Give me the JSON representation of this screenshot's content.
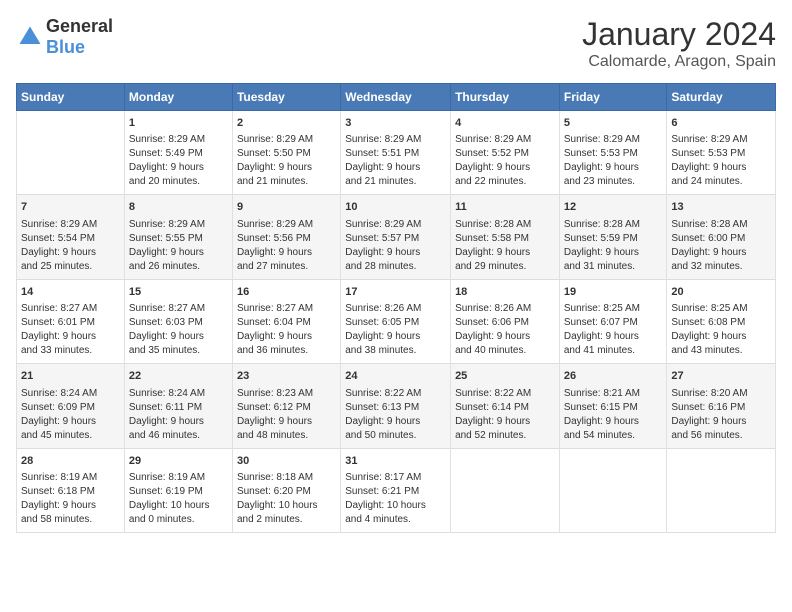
{
  "header": {
    "logo_general": "General",
    "logo_blue": "Blue",
    "month": "January 2024",
    "location": "Calomarde, Aragon, Spain"
  },
  "days_of_week": [
    "Sunday",
    "Monday",
    "Tuesday",
    "Wednesday",
    "Thursday",
    "Friday",
    "Saturday"
  ],
  "weeks": [
    [
      {
        "day": "",
        "info": ""
      },
      {
        "day": "1",
        "info": "Sunrise: 8:29 AM\nSunset: 5:49 PM\nDaylight: 9 hours\nand 20 minutes."
      },
      {
        "day": "2",
        "info": "Sunrise: 8:29 AM\nSunset: 5:50 PM\nDaylight: 9 hours\nand 21 minutes."
      },
      {
        "day": "3",
        "info": "Sunrise: 8:29 AM\nSunset: 5:51 PM\nDaylight: 9 hours\nand 21 minutes."
      },
      {
        "day": "4",
        "info": "Sunrise: 8:29 AM\nSunset: 5:52 PM\nDaylight: 9 hours\nand 22 minutes."
      },
      {
        "day": "5",
        "info": "Sunrise: 8:29 AM\nSunset: 5:53 PM\nDaylight: 9 hours\nand 23 minutes."
      },
      {
        "day": "6",
        "info": "Sunrise: 8:29 AM\nSunset: 5:53 PM\nDaylight: 9 hours\nand 24 minutes."
      }
    ],
    [
      {
        "day": "7",
        "info": "Sunrise: 8:29 AM\nSunset: 5:54 PM\nDaylight: 9 hours\nand 25 minutes."
      },
      {
        "day": "8",
        "info": "Sunrise: 8:29 AM\nSunset: 5:55 PM\nDaylight: 9 hours\nand 26 minutes."
      },
      {
        "day": "9",
        "info": "Sunrise: 8:29 AM\nSunset: 5:56 PM\nDaylight: 9 hours\nand 27 minutes."
      },
      {
        "day": "10",
        "info": "Sunrise: 8:29 AM\nSunset: 5:57 PM\nDaylight: 9 hours\nand 28 minutes."
      },
      {
        "day": "11",
        "info": "Sunrise: 8:28 AM\nSunset: 5:58 PM\nDaylight: 9 hours\nand 29 minutes."
      },
      {
        "day": "12",
        "info": "Sunrise: 8:28 AM\nSunset: 5:59 PM\nDaylight: 9 hours\nand 31 minutes."
      },
      {
        "day": "13",
        "info": "Sunrise: 8:28 AM\nSunset: 6:00 PM\nDaylight: 9 hours\nand 32 minutes."
      }
    ],
    [
      {
        "day": "14",
        "info": "Sunrise: 8:27 AM\nSunset: 6:01 PM\nDaylight: 9 hours\nand 33 minutes."
      },
      {
        "day": "15",
        "info": "Sunrise: 8:27 AM\nSunset: 6:03 PM\nDaylight: 9 hours\nand 35 minutes."
      },
      {
        "day": "16",
        "info": "Sunrise: 8:27 AM\nSunset: 6:04 PM\nDaylight: 9 hours\nand 36 minutes."
      },
      {
        "day": "17",
        "info": "Sunrise: 8:26 AM\nSunset: 6:05 PM\nDaylight: 9 hours\nand 38 minutes."
      },
      {
        "day": "18",
        "info": "Sunrise: 8:26 AM\nSunset: 6:06 PM\nDaylight: 9 hours\nand 40 minutes."
      },
      {
        "day": "19",
        "info": "Sunrise: 8:25 AM\nSunset: 6:07 PM\nDaylight: 9 hours\nand 41 minutes."
      },
      {
        "day": "20",
        "info": "Sunrise: 8:25 AM\nSunset: 6:08 PM\nDaylight: 9 hours\nand 43 minutes."
      }
    ],
    [
      {
        "day": "21",
        "info": "Sunrise: 8:24 AM\nSunset: 6:09 PM\nDaylight: 9 hours\nand 45 minutes."
      },
      {
        "day": "22",
        "info": "Sunrise: 8:24 AM\nSunset: 6:11 PM\nDaylight: 9 hours\nand 46 minutes."
      },
      {
        "day": "23",
        "info": "Sunrise: 8:23 AM\nSunset: 6:12 PM\nDaylight: 9 hours\nand 48 minutes."
      },
      {
        "day": "24",
        "info": "Sunrise: 8:22 AM\nSunset: 6:13 PM\nDaylight: 9 hours\nand 50 minutes."
      },
      {
        "day": "25",
        "info": "Sunrise: 8:22 AM\nSunset: 6:14 PM\nDaylight: 9 hours\nand 52 minutes."
      },
      {
        "day": "26",
        "info": "Sunrise: 8:21 AM\nSunset: 6:15 PM\nDaylight: 9 hours\nand 54 minutes."
      },
      {
        "day": "27",
        "info": "Sunrise: 8:20 AM\nSunset: 6:16 PM\nDaylight: 9 hours\nand 56 minutes."
      }
    ],
    [
      {
        "day": "28",
        "info": "Sunrise: 8:19 AM\nSunset: 6:18 PM\nDaylight: 9 hours\nand 58 minutes."
      },
      {
        "day": "29",
        "info": "Sunrise: 8:19 AM\nSunset: 6:19 PM\nDaylight: 10 hours\nand 0 minutes."
      },
      {
        "day": "30",
        "info": "Sunrise: 8:18 AM\nSunset: 6:20 PM\nDaylight: 10 hours\nand 2 minutes."
      },
      {
        "day": "31",
        "info": "Sunrise: 8:17 AM\nSunset: 6:21 PM\nDaylight: 10 hours\nand 4 minutes."
      },
      {
        "day": "",
        "info": ""
      },
      {
        "day": "",
        "info": ""
      },
      {
        "day": "",
        "info": ""
      }
    ]
  ]
}
